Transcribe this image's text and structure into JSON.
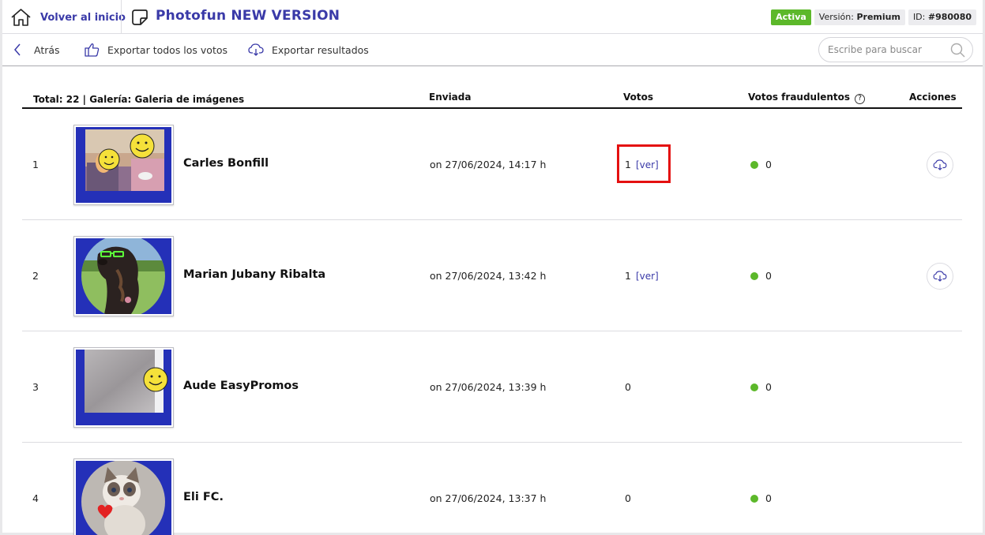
{
  "header": {
    "home_label": "Volver al inicio",
    "app_title": "Photofun NEW VERSION",
    "status_badge": "Activa",
    "version_prefix": "Versión:",
    "version_value": "Premium",
    "id_prefix": "ID:",
    "id_value": "#980080"
  },
  "toolbar": {
    "back_label": "Atrás",
    "export_votes_label": "Exportar todos los votos",
    "export_results_label": "Exportar resultados",
    "search_placeholder": "Escribe para buscar"
  },
  "table": {
    "summary": "Total: 22 | Galería: Galeria de imágenes",
    "col_sent": "Enviada",
    "col_votes": "Votos",
    "col_fraud": "Votos fraudulentos",
    "col_actions": "Acciones",
    "rows": [
      {
        "index": "1",
        "name": "Carles Bonfill",
        "date": "on 27/06/2024, 14:17 h",
        "votes": "1",
        "ver": "[ver]",
        "fraud": "0"
      },
      {
        "index": "2",
        "name": "Marian Jubany Ribalta",
        "date": "on 27/06/2024, 13:42 h",
        "votes": "1",
        "ver": "[ver]",
        "fraud": "0"
      },
      {
        "index": "3",
        "name": "Aude EasyPromos",
        "date": "on 27/06/2024, 13:39 h",
        "votes": "0",
        "fraud": "0"
      },
      {
        "index": "4",
        "name": "Eli FC.",
        "date": "on 27/06/2024, 13:37 h",
        "votes": "0",
        "fraud": "0"
      }
    ]
  },
  "colors": {
    "brand": "#3a3aa8",
    "status_green": "#5cb82a",
    "highlight_red": "#e41010",
    "thumb_background": "#2430b8"
  },
  "icons": [
    "home-icon",
    "sticker-icon",
    "chevron-left-icon",
    "thumbs-up-icon",
    "cloud-download-icon",
    "search-icon",
    "help-icon"
  ]
}
